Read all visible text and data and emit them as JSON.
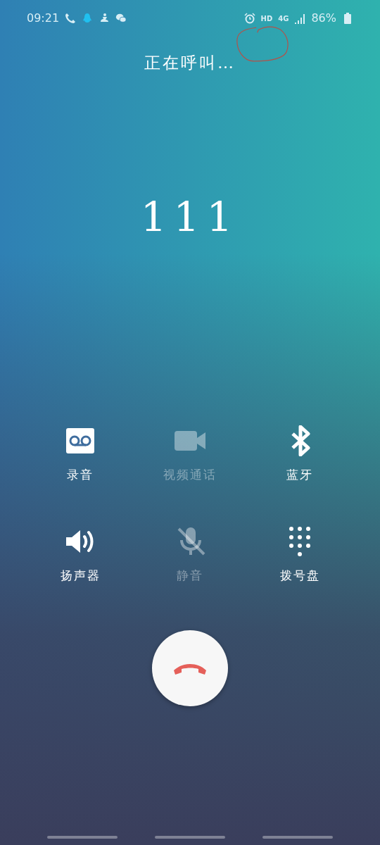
{
  "status_bar": {
    "time": "09:21",
    "hd": "HD",
    "network": "4G",
    "battery": "86%"
  },
  "call": {
    "status": "正在呼叫…",
    "number": "111"
  },
  "controls": [
    {
      "kind": "record",
      "label": "录音",
      "disabled": false
    },
    {
      "kind": "video",
      "label": "视频通话",
      "disabled": true
    },
    {
      "kind": "bluetooth",
      "label": "蓝牙",
      "disabled": false
    },
    {
      "kind": "speaker",
      "label": "扬声器",
      "disabled": false
    },
    {
      "kind": "mute",
      "label": "静音",
      "disabled": true
    },
    {
      "kind": "keypad",
      "label": "拨号盘",
      "disabled": false
    }
  ]
}
